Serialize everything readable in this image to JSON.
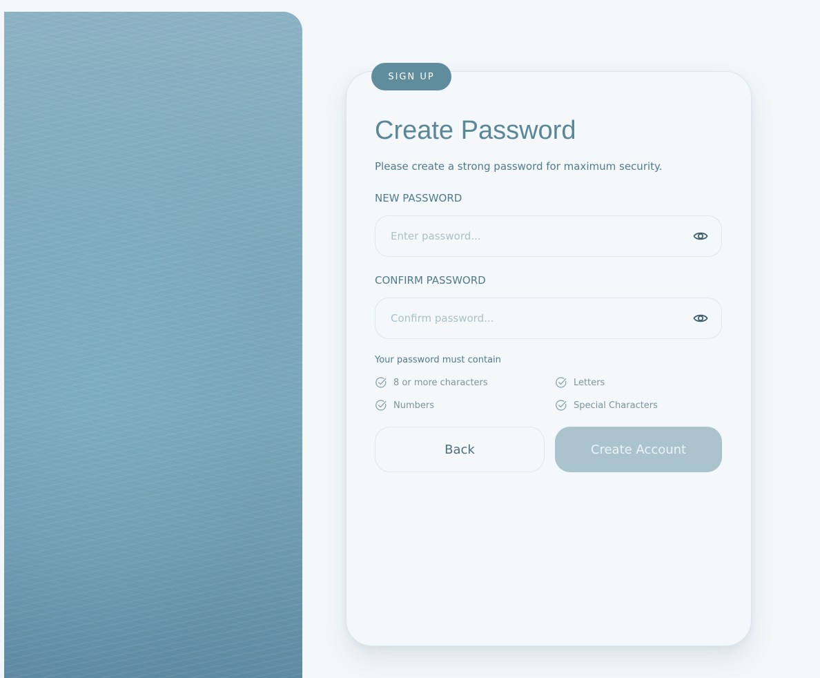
{
  "badge": {
    "label": "SIGN UP"
  },
  "header": {
    "title": "Create Password",
    "subtitle": "Please create a strong password for maximum security."
  },
  "new_password": {
    "label": "NEW PASSWORD",
    "value": "",
    "placeholder": "Enter password...",
    "toggle_icon": "eye-icon"
  },
  "confirm_password": {
    "label": "CONFIRM PASSWORD",
    "value": "",
    "placeholder": "Confirm password...",
    "toggle_icon": "eye-icon"
  },
  "requirements": {
    "title": "Your password must contain",
    "icon": "check-circle-icon",
    "items": [
      "8 or more characters",
      "Letters",
      "Numbers",
      "Special Characters"
    ]
  },
  "buttons": {
    "back_label": "Back",
    "create_label": "Create Account"
  },
  "colors": {
    "accent": "#5f8d9e",
    "background": "#f3f7fa",
    "disabled_button": "#aac3cd"
  }
}
